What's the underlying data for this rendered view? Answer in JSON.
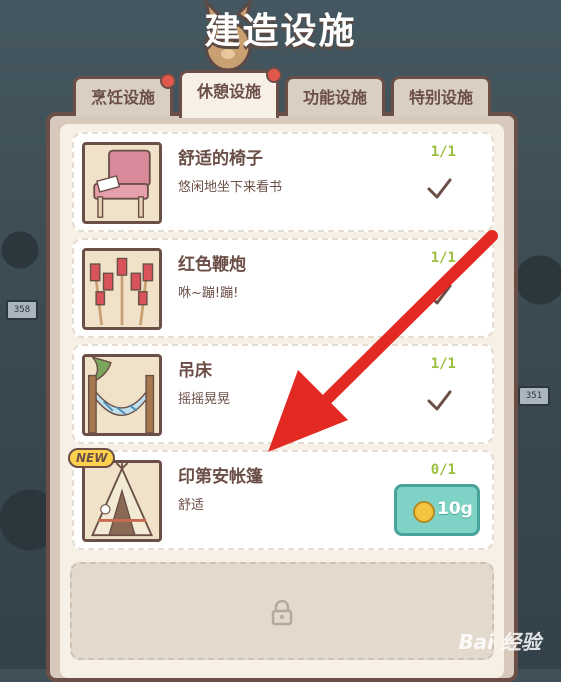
{
  "header": {
    "title": "建造设施"
  },
  "tabs": [
    {
      "label": "烹饪设施",
      "has_notice": true
    },
    {
      "label": "休憩设施",
      "has_notice": true,
      "active": true
    },
    {
      "label": "功能设施",
      "has_notice": false
    },
    {
      "label": "特别设施",
      "has_notice": false
    }
  ],
  "items": [
    {
      "name": "舒适的椅子",
      "desc": "悠闲地坐下来看书",
      "count": "1/1",
      "status": "owned"
    },
    {
      "name": "红色鞭炮",
      "desc": "咻~蹦!蹦!",
      "count": "1/1",
      "status": "owned"
    },
    {
      "name": "吊床",
      "desc": "摇摇晃晃",
      "count": "1/1",
      "status": "owned"
    },
    {
      "name": "印第安帐篷",
      "desc": "舒适",
      "count": "0/1",
      "status": "buy",
      "badge": "NEW",
      "price": "10g"
    }
  ],
  "background_signs": [
    "358",
    "351"
  ],
  "watermark": "Bai 经验",
  "colors": {
    "accent_brown": "#6b4f47",
    "count_green": "#9bbf3f",
    "buy_button": "#7fd3c6",
    "arrow_red": "#e32a22",
    "notice_red": "#e2574c"
  }
}
